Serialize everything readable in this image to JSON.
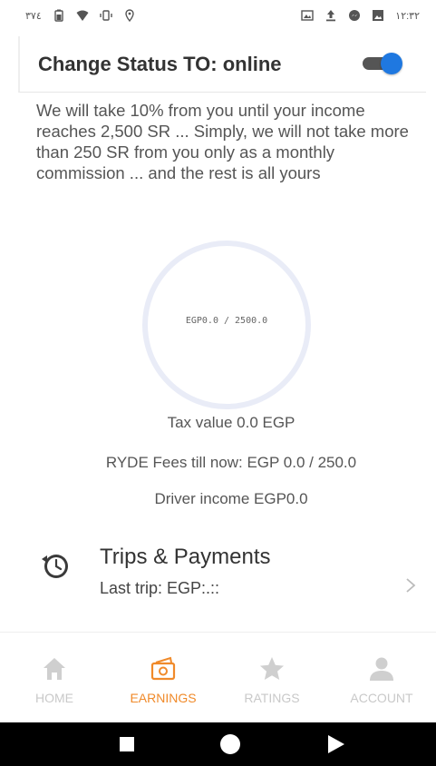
{
  "status_bar": {
    "left_text": "٣٧٤",
    "time": "١٢:٣٢"
  },
  "status_card": {
    "title": "Change Status TO: online",
    "toggle_on": true,
    "accent_color": "#1f78e0"
  },
  "info_text": "We will take 10% from you until your income reaches 2,500 SR ... Simply, we will not take more than 250 SR from you only as a monthly commission ... and the rest is all yours",
  "progress": {
    "label": "EGP0.0 / 2500.0",
    "value": 0.0,
    "max": 2500.0
  },
  "tax_value": "Tax value 0.0 EGP",
  "fees": "RYDE Fees till now: EGP 0.0 / 250.0",
  "driver_income": "Driver income EGP0.0",
  "trips": {
    "title": "Trips & Payments",
    "last_trip": "Last trip: EGP:.::"
  },
  "nav": {
    "items": [
      {
        "label": "HOME",
        "icon": "home-icon",
        "active": false
      },
      {
        "label": "EARNINGS",
        "icon": "earnings-icon",
        "active": true
      },
      {
        "label": "RATINGS",
        "icon": "star-icon",
        "active": false
      },
      {
        "label": "ACCOUNT",
        "icon": "account-icon",
        "active": false
      }
    ],
    "active_color": "#f08a2a",
    "inactive_color": "#c9c9c9"
  }
}
